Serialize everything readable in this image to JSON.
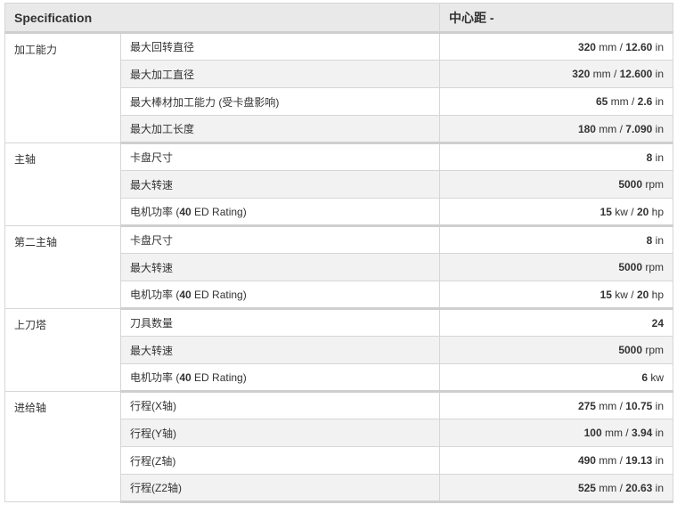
{
  "header": {
    "spec_label": "Specification",
    "col_label": "中心距 -"
  },
  "groups": [
    {
      "name": "加工能力",
      "rows": [
        {
          "label": "最大回转直径",
          "value": [
            [
              "320",
              " mm / "
            ],
            [
              "12.60",
              " in"
            ]
          ]
        },
        {
          "label": "最大加工直径",
          "value": [
            [
              "320",
              " mm / "
            ],
            [
              "12.600",
              " in"
            ]
          ]
        },
        {
          "label": "最大棒材加工能力 (受卡盘影响)",
          "value": [
            [
              "65",
              " mm / "
            ],
            [
              "2.6",
              " in"
            ]
          ]
        },
        {
          "label": "最大加工长度",
          "value": [
            [
              "180",
              " mm / "
            ],
            [
              "7.090",
              " in"
            ]
          ]
        }
      ]
    },
    {
      "name": "主轴",
      "rows": [
        {
          "label": "卡盘尺寸",
          "value": [
            [
              "8",
              " in"
            ]
          ]
        },
        {
          "label": "最大转速",
          "value": [
            [
              "5000",
              " rpm"
            ]
          ]
        },
        {
          "label": [
            "电机功率 (",
            "40",
            " ED Rating)"
          ],
          "value": [
            [
              "15",
              " kw / "
            ],
            [
              "20",
              " hp"
            ]
          ]
        }
      ]
    },
    {
      "name": "第二主轴",
      "rows": [
        {
          "label": "卡盘尺寸",
          "value": [
            [
              "8",
              " in"
            ]
          ]
        },
        {
          "label": "最大转速",
          "value": [
            [
              "5000",
              " rpm"
            ]
          ]
        },
        {
          "label": [
            "电机功率 (",
            "40",
            " ED Rating)"
          ],
          "value": [
            [
              "15",
              " kw / "
            ],
            [
              "20",
              " hp"
            ]
          ]
        }
      ]
    },
    {
      "name": "上刀塔",
      "rows": [
        {
          "label": "刀具数量",
          "value": [
            [
              "24",
              ""
            ]
          ]
        },
        {
          "label": "最大转速",
          "value": [
            [
              "5000",
              " rpm"
            ]
          ]
        },
        {
          "label": [
            "电机功率 (",
            "40",
            " ED Rating)"
          ],
          "value": [
            [
              "6",
              " kw"
            ]
          ]
        }
      ]
    },
    {
      "name": "进给轴",
      "rows": [
        {
          "label": "行程(X轴)",
          "value": [
            [
              "275",
              " mm / "
            ],
            [
              "10.75",
              " in"
            ]
          ]
        },
        {
          "label": "行程(Y轴)",
          "value": [
            [
              "100",
              " mm / "
            ],
            [
              "3.94",
              " in"
            ]
          ]
        },
        {
          "label": "行程(Z轴)",
          "value": [
            [
              "490",
              " mm / "
            ],
            [
              "19.13",
              " in"
            ]
          ]
        },
        {
          "label": "行程(Z2轴)",
          "value": [
            [
              "525",
              " mm / "
            ],
            [
              "20.63",
              " in"
            ]
          ]
        }
      ]
    }
  ]
}
